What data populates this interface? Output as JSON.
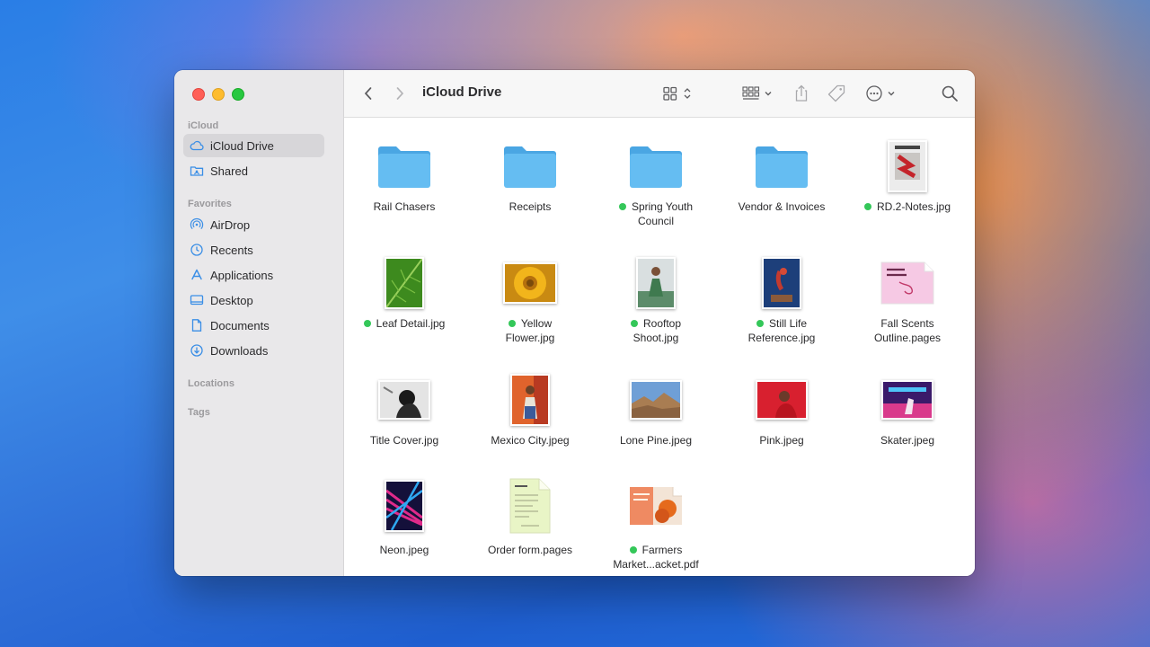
{
  "window": {
    "title": "iCloud Drive"
  },
  "sidebar": {
    "sections": {
      "icloud": "iCloud",
      "favorites": "Favorites",
      "locations": "Locations",
      "tags": "Tags"
    },
    "icloud_items": [
      {
        "label": "iCloud Drive",
        "icon": "cloud-icon",
        "selected": true
      },
      {
        "label": "Shared",
        "icon": "shared-folder-icon"
      }
    ],
    "favorites_items": [
      {
        "label": "AirDrop",
        "icon": "airdrop-icon"
      },
      {
        "label": "Recents",
        "icon": "clock-icon"
      },
      {
        "label": "Applications",
        "icon": "applications-icon"
      },
      {
        "label": "Desktop",
        "icon": "desktop-icon"
      },
      {
        "label": "Documents",
        "icon": "document-icon"
      },
      {
        "label": "Downloads",
        "icon": "download-icon"
      }
    ]
  },
  "toolbar": {
    "back": "chevron-left-icon",
    "forward": "chevron-right-icon",
    "view": "grid-view-icon",
    "group": "group-icon",
    "share": "share-icon",
    "tag": "tag-icon",
    "more": "ellipsis-circle-icon",
    "search": "search-icon"
  },
  "colors": {
    "tag_green": "#34c759",
    "folder_blue": "#5bb8f0",
    "selection": "#d7d6d9"
  },
  "files": [
    {
      "line1": "Rail Chasers",
      "line2": "",
      "type": "folder",
      "tag": false
    },
    {
      "line1": "Receipts",
      "line2": "",
      "type": "folder",
      "tag": false
    },
    {
      "line1": "Spring Youth",
      "line2": "Council",
      "type": "folder",
      "tag": true
    },
    {
      "line1": "Vendor & Invoices",
      "line2": "",
      "type": "folder",
      "tag": false
    },
    {
      "line1": "RD.2-Notes.jpg",
      "line2": "",
      "type": "image",
      "tag": true
    },
    {
      "line1": "Leaf Detail.jpg",
      "line2": "",
      "type": "image",
      "tag": true
    },
    {
      "line1": "Yellow",
      "line2": "Flower.jpg",
      "type": "image",
      "tag": true
    },
    {
      "line1": "Rooftop",
      "line2": "Shoot.jpg",
      "type": "image",
      "tag": true
    },
    {
      "line1": "Still Life",
      "line2": "Reference.jpg",
      "type": "image",
      "tag": true
    },
    {
      "line1": "Fall Scents",
      "line2": "Outline.pages",
      "type": "document",
      "tag": false
    },
    {
      "line1": "Title Cover.jpg",
      "line2": "",
      "type": "image",
      "tag": false
    },
    {
      "line1": "Mexico City.jpeg",
      "line2": "",
      "type": "image",
      "tag": false
    },
    {
      "line1": "Lone Pine.jpeg",
      "line2": "",
      "type": "image",
      "tag": false
    },
    {
      "line1": "Pink.jpeg",
      "line2": "",
      "type": "image",
      "tag": false
    },
    {
      "line1": "Skater.jpeg",
      "line2": "",
      "type": "image",
      "tag": false
    },
    {
      "line1": "Neon.jpeg",
      "line2": "",
      "type": "image",
      "tag": false
    },
    {
      "line1": "Order form.pages",
      "line2": "",
      "type": "document",
      "tag": false
    },
    {
      "line1": "Farmers",
      "line2": "Market...acket.pdf",
      "type": "document",
      "tag": true
    }
  ]
}
